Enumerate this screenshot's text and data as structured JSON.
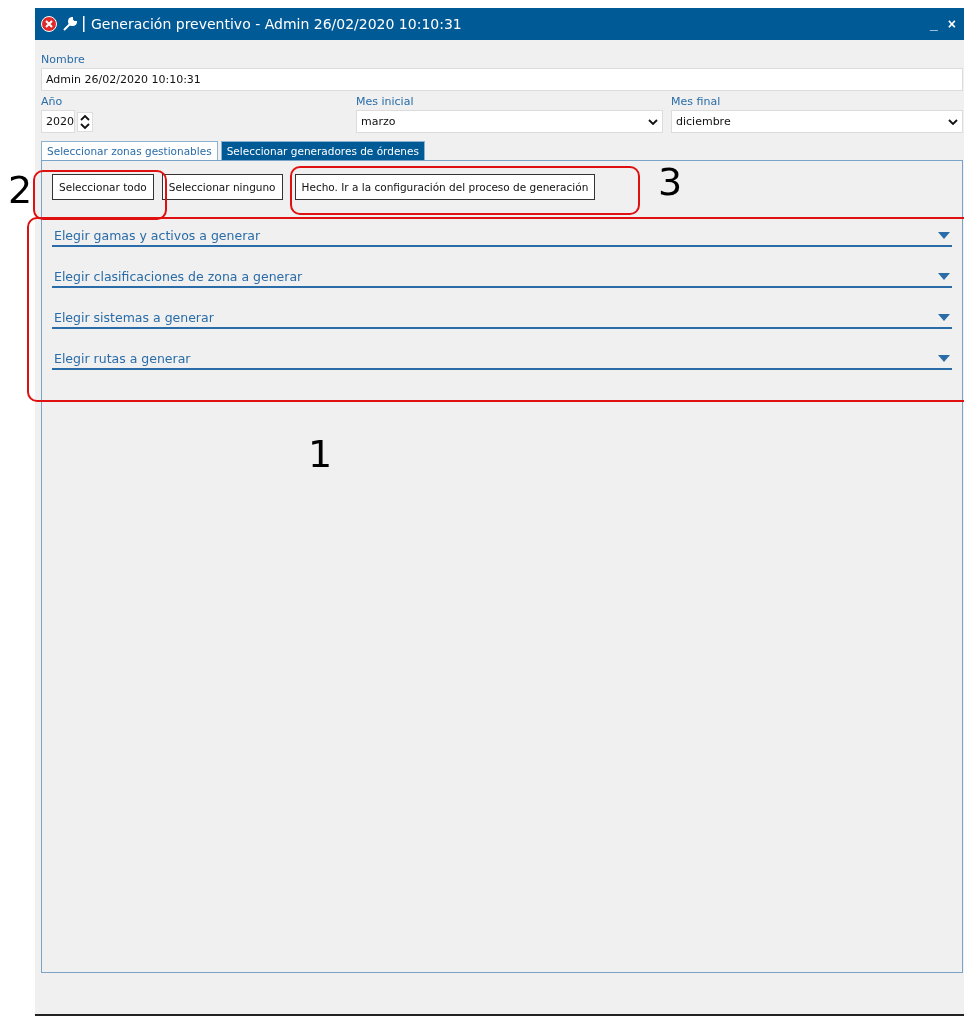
{
  "window": {
    "title": "Generación preventivo -  Admin 26/02/2020 10:10:31",
    "minimize": "_",
    "close": "×"
  },
  "name_field": {
    "label": "Nombre",
    "value": "Admin 26/02/2020 10:10:31"
  },
  "year_field": {
    "label": "Año",
    "value": "2020"
  },
  "start_month": {
    "label": "Mes inicial",
    "value": "marzo"
  },
  "end_month": {
    "label": "Mes final",
    "value": "diciembre"
  },
  "tabs": [
    {
      "label": "Seleccionar zonas gestionables",
      "selected": false
    },
    {
      "label": "Seleccionar generadores de órdenes",
      "selected": true
    }
  ],
  "buttons": [
    "Seleccionar todo",
    "Seleccionar ninguno",
    "Hecho. Ir a la configuración del proceso de generación"
  ],
  "sections": [
    {
      "title": "Elegir gamas y activos a generar",
      "expanded": false
    },
    {
      "title": "Elegir clasificaciones de zona a generar",
      "expanded": false
    },
    {
      "title": "Elegir sistemas a generar",
      "expanded": false
    },
    {
      "title": "Elegir rutas a generar",
      "expanded": false
    }
  ],
  "annotations": [
    {
      "label": "2"
    },
    {
      "label": "3"
    },
    {
      "label": "1"
    }
  ]
}
